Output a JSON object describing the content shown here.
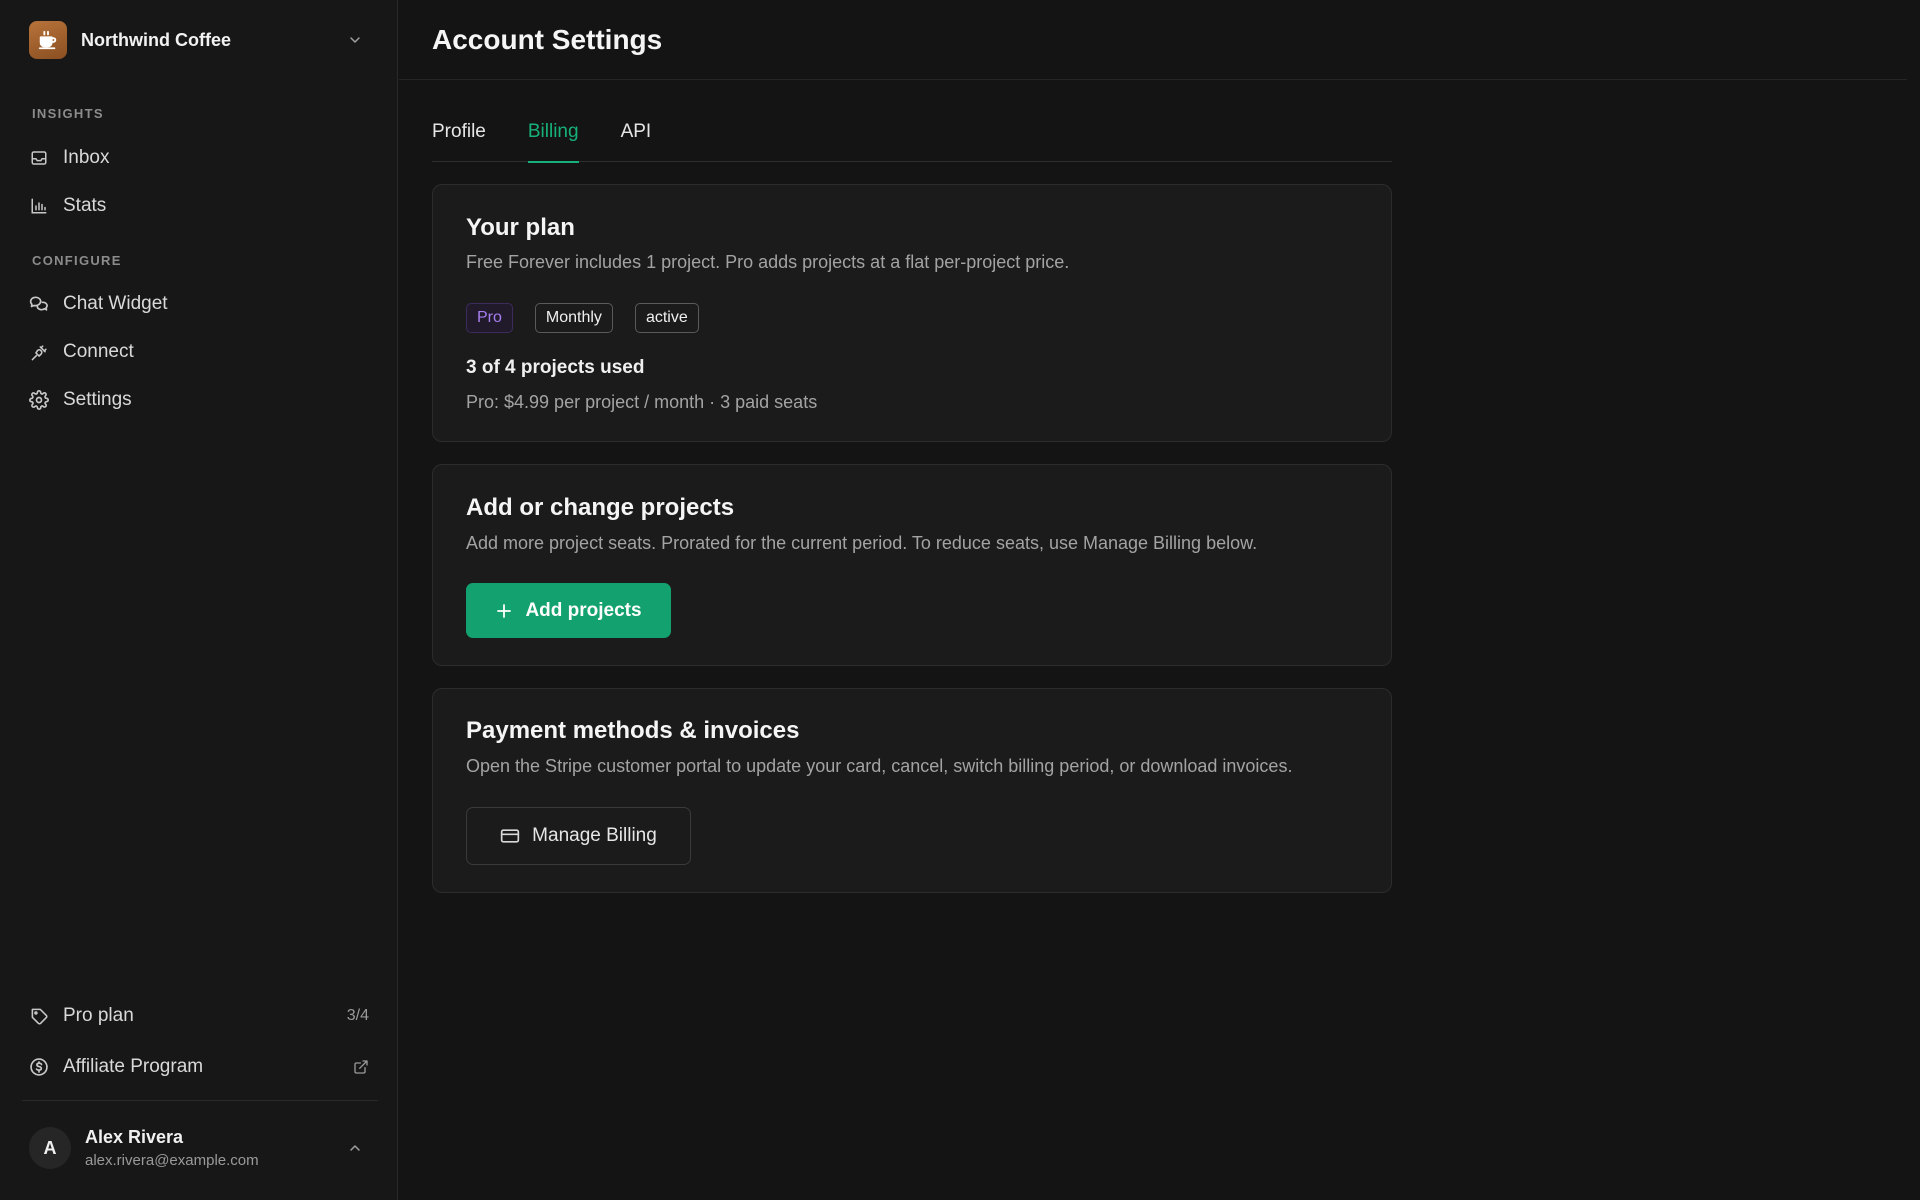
{
  "org": {
    "name": "Northwind Coffee"
  },
  "sidebar": {
    "sections": [
      {
        "label": "INSIGHTS"
      },
      {
        "label": "CONFIGURE"
      }
    ],
    "items": [
      {
        "label": "Inbox",
        "icon": "inbox-icon"
      },
      {
        "label": "Stats",
        "icon": "bar-chart-icon"
      },
      {
        "label": "Chat Widget",
        "icon": "chat-bubbles-icon"
      },
      {
        "label": "Connect",
        "icon": "plug-icon"
      },
      {
        "label": "Settings",
        "icon": "gear-icon"
      }
    ],
    "bottom": {
      "plan": {
        "label": "Pro plan",
        "meta": "3/4",
        "icon": "tag-icon"
      },
      "affiliate": {
        "label": "Affiliate Program",
        "icon": "dollar-circle-icon",
        "meta_icon": "external-link-icon"
      }
    }
  },
  "user": {
    "initial": "A",
    "name": "Alex Rivera",
    "email": "alex.rivera@example.com"
  },
  "header": {
    "title": "Account Settings"
  },
  "tabs": [
    {
      "label": "Profile",
      "active": false
    },
    {
      "label": "Billing",
      "active": true
    },
    {
      "label": "API",
      "active": false
    }
  ],
  "plan_card": {
    "title": "Your plan",
    "description": "Free Forever includes 1 project. Pro adds projects at a flat per-project price.",
    "badges": [
      "Pro",
      "Monthly",
      "active"
    ],
    "usage": "3 of 4 projects used",
    "pricing": "Pro: $4.99 per project / month · 3 paid seats"
  },
  "projects_card": {
    "title": "Add or change projects",
    "description": "Add more project seats. Prorated for the current period. To reduce seats, use Manage Billing below.",
    "button": "Add projects"
  },
  "payment_card": {
    "title": "Payment methods & invoices",
    "description": "Open the Stripe customer portal to update your card, cancel, switch billing period, or download invoices.",
    "button": "Manage Billing"
  },
  "colors": {
    "accent": "#16b17a",
    "primary_button": "#13a16f",
    "pro_badge": "#a77ef0",
    "background": "#141414",
    "card": "#1b1b1b"
  }
}
